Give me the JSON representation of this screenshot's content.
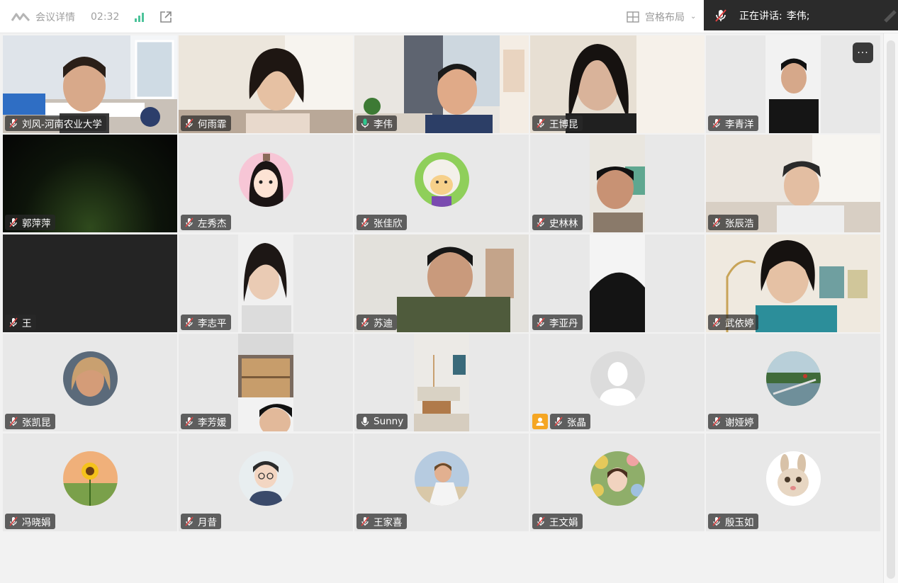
{
  "topbar": {
    "meeting_details": "会议详情",
    "timer": "02:32",
    "layout_label": "宫格布局",
    "speaking_label": "正在讲话:",
    "speaking_name": "李伟;"
  },
  "icons": [
    "logo-icon",
    "signal-icon",
    "external-link-icon",
    "grid-layout-icon",
    "chevron-down-icon",
    "mic-muted-icon",
    "mic-active-icon",
    "more-icon",
    "host-icon"
  ],
  "colors": {
    "active_border": "#2fc78e",
    "speaking_bar": "#2b2b2b",
    "host_badge": "#f5a623",
    "signal": "#4cc39a"
  },
  "tiles": [
    {
      "name": "刘风-河南农业大学",
      "mic": "muted",
      "kind": "video"
    },
    {
      "name": "何雨霏",
      "mic": "muted",
      "kind": "video"
    },
    {
      "name": "李伟",
      "mic": "active",
      "kind": "video",
      "active": true
    },
    {
      "name": "王博昆",
      "mic": "muted",
      "kind": "video"
    },
    {
      "name": "李青洋",
      "mic": "muted",
      "kind": "video",
      "more": "···"
    },
    {
      "name": "郭萍萍",
      "mic": "muted",
      "kind": "dark-video"
    },
    {
      "name": "左秀杰",
      "mic": "muted",
      "kind": "avatar"
    },
    {
      "name": "张佳欣",
      "mic": "muted",
      "kind": "avatar"
    },
    {
      "name": "史林林",
      "mic": "muted",
      "kind": "video"
    },
    {
      "name": "张辰浩",
      "mic": "muted",
      "kind": "video"
    },
    {
      "name": "王",
      "mic": "muted",
      "kind": "dark"
    },
    {
      "name": "李志平",
      "mic": "muted",
      "kind": "video"
    },
    {
      "name": "苏迪",
      "mic": "muted",
      "kind": "video"
    },
    {
      "name": "李亚丹",
      "mic": "muted",
      "kind": "video"
    },
    {
      "name": "武依婷",
      "mic": "muted",
      "kind": "video"
    },
    {
      "name": "张凯昆",
      "mic": "muted",
      "kind": "avatar"
    },
    {
      "name": "李芳媛",
      "mic": "muted",
      "kind": "video"
    },
    {
      "name": "Sunny",
      "mic": "on",
      "kind": "video"
    },
    {
      "name": "张晶",
      "mic": "muted",
      "kind": "avatar",
      "host": true
    },
    {
      "name": "谢娅婷",
      "mic": "muted",
      "kind": "avatar"
    },
    {
      "name": "冯晓娟",
      "mic": "muted",
      "kind": "avatar"
    },
    {
      "name": "月昔",
      "mic": "muted",
      "kind": "avatar"
    },
    {
      "name": "王家喜",
      "mic": "muted",
      "kind": "avatar"
    },
    {
      "name": "王文娟",
      "mic": "muted",
      "kind": "avatar"
    },
    {
      "name": "殷玉如",
      "mic": "muted",
      "kind": "avatar"
    }
  ]
}
